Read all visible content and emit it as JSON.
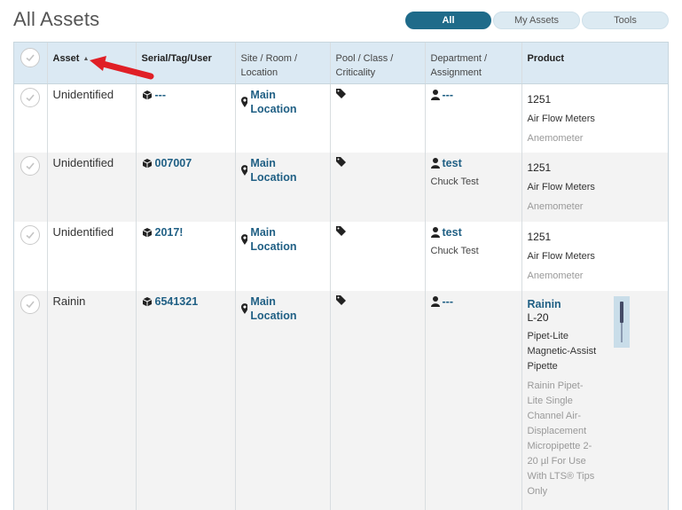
{
  "page": {
    "title": "All Assets"
  },
  "tabs": [
    {
      "label": "All",
      "active": true
    },
    {
      "label": "My Assets",
      "active": false
    },
    {
      "label": "Tools",
      "active": false
    }
  ],
  "columns": {
    "asset": "Asset",
    "serial": "Serial/Tag/User",
    "site": "Site / Room / Location",
    "pool": "Pool / Class / Criticality",
    "department": "Department / Assignment",
    "product": "Product"
  },
  "rows": [
    {
      "asset": "Unidentified",
      "serial": "---",
      "location": "Main Location",
      "department": "---",
      "assignee": "",
      "product": {
        "number": "1251",
        "category": "Air Flow Meters",
        "type": "Anemometer"
      }
    },
    {
      "asset": "Unidentified",
      "serial": "007007",
      "location": "Main Location",
      "department": "test",
      "assignee": "Chuck Test",
      "product": {
        "number": "1251",
        "category": "Air Flow Meters",
        "type": "Anemometer"
      }
    },
    {
      "asset": "Unidentified",
      "serial": "2017!",
      "location": "Main Location",
      "department": "test",
      "assignee": "Chuck Test",
      "product": {
        "number": "1251",
        "category": "Air Flow Meters",
        "type": "Anemometer"
      }
    },
    {
      "asset": "Rainin",
      "serial": "6541321",
      "location": "Main Location",
      "department": "---",
      "assignee": "",
      "product": {
        "brand": "Rainin",
        "model": "L-20",
        "description": "Pipet-Lite Magnetic-Assist Pipette",
        "long_description": "Rainin Pipet-Lite Single Channel Air-Displacement Micropipette 2-20 µl For Use With LTS® Tips Only"
      }
    }
  ],
  "icons": {
    "checkmark": "check-icon",
    "serial": "cube-icon",
    "location": "map-marker-icon",
    "pool": "tag-icon",
    "department": "user-icon",
    "sort": "sort-ascending-icon",
    "annotation": "red-arrow-icon"
  },
  "colors": {
    "accent": "#1f6b8a",
    "link": "#1f5f84",
    "header_bg": "#dbe9f3",
    "annotation_arrow": "#e01f26"
  }
}
